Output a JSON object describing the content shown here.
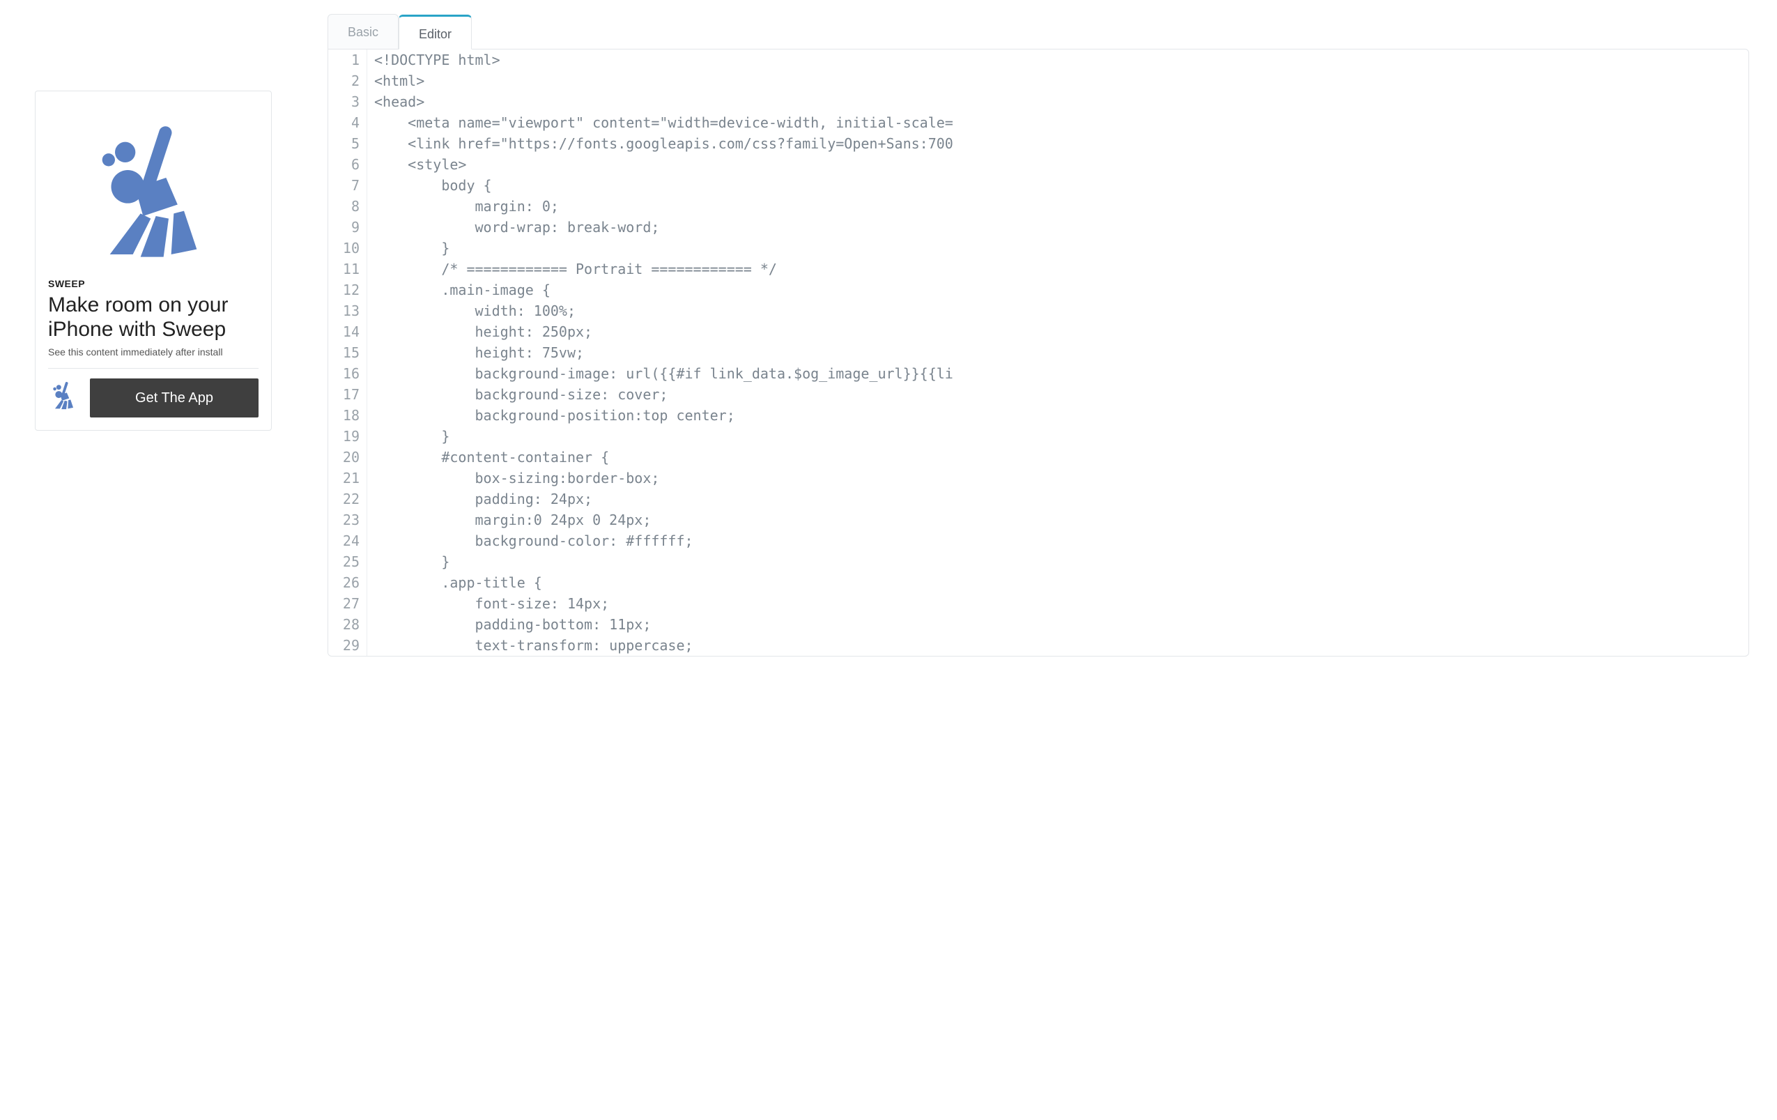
{
  "tabs": [
    {
      "label": "Basic",
      "active": false
    },
    {
      "label": "Editor",
      "active": true
    }
  ],
  "preview": {
    "app_title": "SWEEP",
    "headline": "Make room on your iPhone with Sweep",
    "sub_note": "See this content immediately after install",
    "cta_label": "Get The App",
    "icon_name": "broom-icon",
    "accent_color": "#5a80c2"
  },
  "editor": {
    "lines": [
      "<!DOCTYPE html>",
      "<html>",
      "<head>",
      "    <meta name=\"viewport\" content=\"width=device-width, initial-scale=",
      "    <link href=\"https://fonts.googleapis.com/css?family=Open+Sans:700",
      "    <style>",
      "        body {",
      "            margin: 0;",
      "            word-wrap: break-word;",
      "        }",
      "        /* ============ Portrait ============ */",
      "        .main-image {",
      "            width: 100%;",
      "            height: 250px;",
      "            height: 75vw;",
      "            background-image: url({{#if link_data.$og_image_url}}{{li",
      "            background-size: cover;",
      "            background-position:top center;",
      "        }",
      "        #content-container {",
      "            box-sizing:border-box;",
      "            padding: 24px;",
      "            margin:0 24px 0 24px;",
      "            background-color: #ffffff;",
      "        }",
      "        .app-title {",
      "            font-size: 14px;",
      "            padding-bottom: 11px;",
      "            text-transform: uppercase;"
    ]
  }
}
